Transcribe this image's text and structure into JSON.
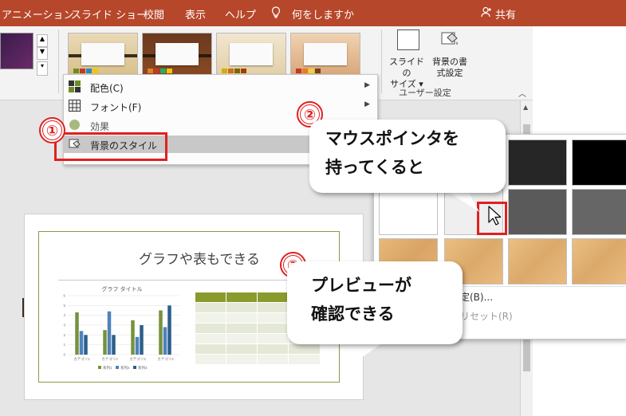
{
  "ribbon_tabs": [
    "アニメーション",
    "スライド ショー",
    "校閲",
    "表示",
    "ヘルプ"
  ],
  "tell_me": "何をしますか",
  "share": "共有",
  "customize": {
    "slide_size": [
      "スライドの",
      "サイズ"
    ],
    "format_bg": [
      "背景の書",
      "式設定"
    ],
    "group_label": "ユーザー設定"
  },
  "menu": {
    "items": [
      {
        "label": "配色(C)",
        "arrow": "▶"
      },
      {
        "label": "フォント(F)",
        "arrow": "▶"
      },
      {
        "label": "効果",
        "arrow": ""
      },
      {
        "label": "背景のスタイル",
        "arrow": ""
      }
    ]
  },
  "palette": {
    "item_b": "定(B)...",
    "item_r": "リセット(R)"
  },
  "slide": {
    "title": "グラフや表もできる",
    "chart_title": "グラフ タイトル",
    "legend": [
      "系列1",
      "系列2",
      "系列3"
    ]
  },
  "chart_data": {
    "type": "bar",
    "categories": [
      "カテゴリ1",
      "カテゴリ2",
      "カテゴリ3",
      "カテゴリ4"
    ],
    "series": [
      {
        "name": "系列1",
        "values": [
          4.3,
          2.5,
          3.5,
          4.5
        ]
      },
      {
        "name": "系列2",
        "values": [
          2.4,
          4.4,
          1.8,
          2.8
        ]
      },
      {
        "name": "系列3",
        "values": [
          2,
          2,
          3,
          5
        ]
      }
    ],
    "ylim": [
      0,
      6
    ],
    "yticks": [
      "0",
      "1",
      "2",
      "3",
      "4",
      "5",
      "6"
    ]
  },
  "callouts": {
    "step1": "①",
    "step2": "②",
    "step3": "③",
    "text2": [
      "マウスポインタを",
      "持ってくると"
    ],
    "text3": [
      "プレビューが",
      "確認できる"
    ]
  },
  "colors": {
    "title_bar": "#b7472a",
    "accent_red": "#e02020",
    "series1": "#76923c",
    "series2": "#4f81bd",
    "series3": "#2c5f8a"
  }
}
